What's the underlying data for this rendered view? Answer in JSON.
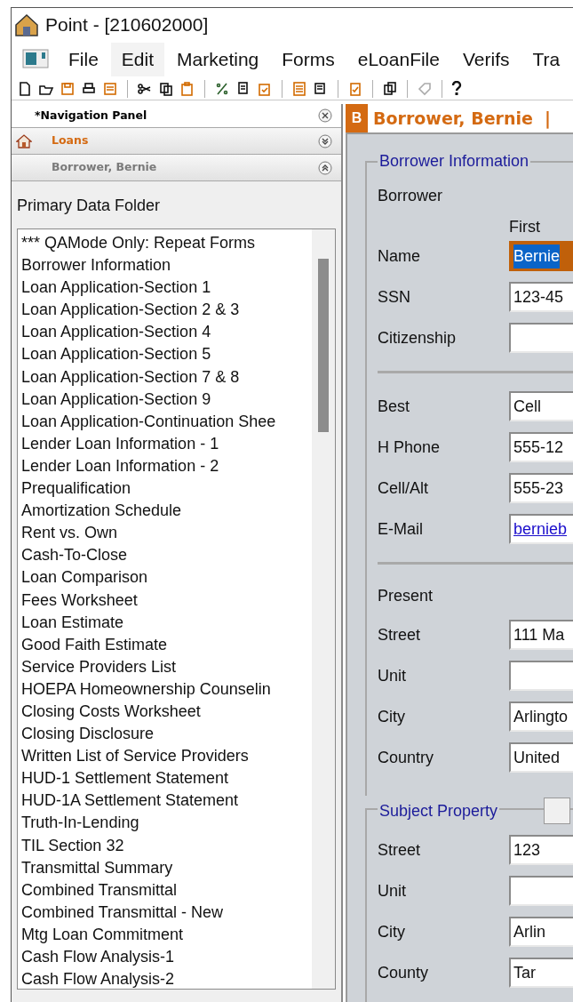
{
  "window": {
    "title": "Point - [210602000]"
  },
  "menu": [
    {
      "label": "File",
      "selected": false
    },
    {
      "label": "Edit",
      "selected": true
    },
    {
      "label": "Marketing",
      "selected": false
    },
    {
      "label": "Forms",
      "selected": false
    },
    {
      "label": "eLoanFile",
      "selected": false
    },
    {
      "label": "Verifs",
      "selected": false
    },
    {
      "label": "Tra",
      "selected": false
    }
  ],
  "nav_panel": {
    "title": "*Navigation Panel",
    "sections": [
      {
        "label": "Loans",
        "expanded": false,
        "kind": "home"
      },
      {
        "label": "Borrower, Bernie",
        "expanded": true,
        "kind": "plain"
      }
    ],
    "folder_title": "Primary Data Folder",
    "items": [
      {
        "label": "*** QAMode Only: Repeat Forms"
      },
      {
        "label": "Borrower Information"
      },
      {
        "label": "Loan Application-Section 1"
      },
      {
        "label": "Loan Application-Section 2 & 3"
      },
      {
        "label": "Loan Application-Section 4"
      },
      {
        "label": "Loan Application-Section 5"
      },
      {
        "label": "Loan Application-Section 7 & 8"
      },
      {
        "label": "Loan Application-Section 9"
      },
      {
        "label": "Loan Application-Continuation Shee"
      },
      {
        "label": "Lender Loan Information - 1"
      },
      {
        "label": "Lender Loan Information - 2"
      },
      {
        "label": "Prequalification"
      },
      {
        "label": "Amortization Schedule"
      },
      {
        "label": "Rent vs. Own"
      },
      {
        "label": "Cash-To-Close"
      },
      {
        "label": "Loan Comparison"
      },
      {
        "label": "Fees Worksheet"
      },
      {
        "label": "Loan Estimate"
      },
      {
        "label": "Good Faith Estimate"
      },
      {
        "label": "Service Providers List"
      },
      {
        "label": "HOEPA Homeownership Counselin"
      },
      {
        "label": "Closing Costs Worksheet"
      },
      {
        "label": "Closing Disclosure"
      },
      {
        "label": "Written List of Service Providers"
      },
      {
        "label": "HUD-1 Settlement Statement"
      },
      {
        "label": "HUD-1A Settlement Statement"
      },
      {
        "label": "Truth-In-Lending"
      },
      {
        "label": "TIL Section 32"
      },
      {
        "label": "Transmittal Summary"
      },
      {
        "label": "Combined Transmittal"
      },
      {
        "label": "Combined Transmittal - New"
      },
      {
        "label": "Mtg Loan Commitment"
      },
      {
        "label": "Cash Flow Analysis-1"
      },
      {
        "label": "Cash Flow Analysis-2"
      }
    ]
  },
  "form": {
    "badge": "B",
    "title": "Borrower, Bernie  |",
    "sections": [
      {
        "title": "Borrower Information",
        "groups": [
          [
            {
              "kind": "heading",
              "label": "Borrower"
            },
            {
              "kind": "column",
              "label": "First"
            },
            {
              "kind": "field",
              "label": "Name",
              "value": "Bernie",
              "focused": true
            },
            {
              "kind": "field",
              "label": "SSN",
              "value": "123-45"
            },
            {
              "kind": "field",
              "label": "Citizenship"
            }
          ],
          [
            {
              "kind": "field",
              "label": "Best",
              "value": "Cell"
            },
            {
              "kind": "field",
              "label": "H Phone",
              "value": "555-12"
            },
            {
              "kind": "field",
              "label": "Cell/Alt",
              "value": "555-23"
            },
            {
              "kind": "link",
              "label": "E-Mail",
              "value": "bernieb"
            }
          ],
          [
            {
              "kind": "heading",
              "label": "Present"
            },
            {
              "kind": "field",
              "label": "Street",
              "value": "111 Ma"
            },
            {
              "kind": "field",
              "label": "Unit"
            },
            {
              "kind": "field",
              "label": "City",
              "value": "Arlingto"
            },
            {
              "kind": "field",
              "label": "Country",
              "value": "United"
            }
          ]
        ]
      },
      {
        "title": "Subject Property",
        "groups": [
          [
            {
              "kind": "field",
              "label": "Street",
              "value": "123"
            },
            {
              "kind": "field",
              "label": "Unit"
            },
            {
              "kind": "field",
              "label": "City",
              "value": "Arlin"
            },
            {
              "kind": "field",
              "label": "County",
              "value": "Tar"
            }
          ]
        ]
      }
    ]
  }
}
